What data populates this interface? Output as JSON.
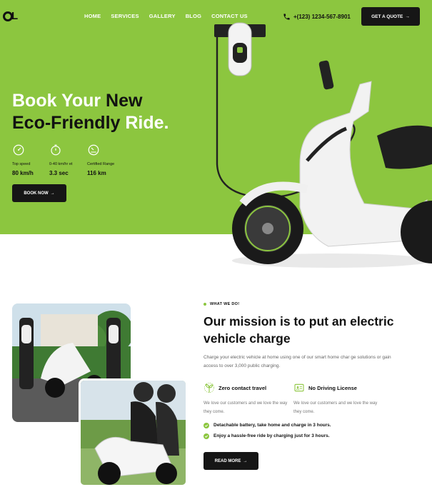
{
  "brand": {
    "logo_text": "L",
    "accent_color": "#8cc63f",
    "dark_color": "#161616"
  },
  "nav": {
    "items": [
      "HOME",
      "SERVICES",
      "GALLERY",
      "BLOG",
      "CONTACT US"
    ]
  },
  "header": {
    "phone": "+(123) 1234-567-8901",
    "phone_icon": "phone-icon",
    "quote_label": "GET A QUOTE",
    "arrow": "→"
  },
  "hero": {
    "title_light": "Book Your",
    "title_dark_1": "New",
    "title_dark_2": "Eco-Friendly",
    "title_light_2": "Ride.",
    "stats": [
      {
        "icon": "speedometer-icon",
        "label": "Top speed",
        "value": "80 km/h"
      },
      {
        "icon": "stopwatch-icon",
        "label": "0-40 km/hr et",
        "value": "3.3 sec"
      },
      {
        "icon": "gauge-icon",
        "label": "Certified Range",
        "value": "116 km"
      }
    ],
    "book_label": "BOOK NOW",
    "arrow": "→"
  },
  "mission": {
    "eyebrow": "WHAT WE DO!",
    "title": "Our mission is to put an electric vehicle charge",
    "description": "Charge your electric vehicle at home using one of our smart home char ge solutions or gain access to over 3,000 public charging.",
    "features": [
      {
        "icon": "eco-plant-icon",
        "title": "Zero contact travel",
        "desc": "We love our customers and we love the way they come."
      },
      {
        "icon": "license-card-icon",
        "title": "No Driving License",
        "desc": "We love our customers and we love the way they come."
      }
    ],
    "checks": [
      "Detachable battery, take home and charge in 3 hours.",
      "Enjoy a hassle-free ride by charging just for 3 hours."
    ],
    "read_label": "READ MORE",
    "arrow": "→"
  }
}
